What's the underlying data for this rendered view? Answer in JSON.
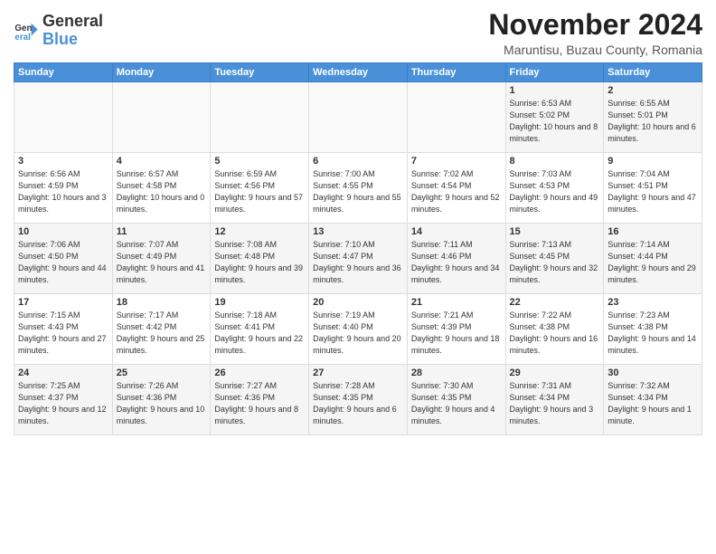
{
  "logo": {
    "line1": "General",
    "line2": "Blue"
  },
  "title": "November 2024",
  "subtitle": "Maruntisu, Buzau County, Romania",
  "weekdays": [
    "Sunday",
    "Monday",
    "Tuesday",
    "Wednesday",
    "Thursday",
    "Friday",
    "Saturday"
  ],
  "weeks": [
    [
      {
        "day": "",
        "info": ""
      },
      {
        "day": "",
        "info": ""
      },
      {
        "day": "",
        "info": ""
      },
      {
        "day": "",
        "info": ""
      },
      {
        "day": "",
        "info": ""
      },
      {
        "day": "1",
        "info": "Sunrise: 6:53 AM\nSunset: 5:02 PM\nDaylight: 10 hours and 8 minutes."
      },
      {
        "day": "2",
        "info": "Sunrise: 6:55 AM\nSunset: 5:01 PM\nDaylight: 10 hours and 6 minutes."
      }
    ],
    [
      {
        "day": "3",
        "info": "Sunrise: 6:56 AM\nSunset: 4:59 PM\nDaylight: 10 hours and 3 minutes."
      },
      {
        "day": "4",
        "info": "Sunrise: 6:57 AM\nSunset: 4:58 PM\nDaylight: 10 hours and 0 minutes."
      },
      {
        "day": "5",
        "info": "Sunrise: 6:59 AM\nSunset: 4:56 PM\nDaylight: 9 hours and 57 minutes."
      },
      {
        "day": "6",
        "info": "Sunrise: 7:00 AM\nSunset: 4:55 PM\nDaylight: 9 hours and 55 minutes."
      },
      {
        "day": "7",
        "info": "Sunrise: 7:02 AM\nSunset: 4:54 PM\nDaylight: 9 hours and 52 minutes."
      },
      {
        "day": "8",
        "info": "Sunrise: 7:03 AM\nSunset: 4:53 PM\nDaylight: 9 hours and 49 minutes."
      },
      {
        "day": "9",
        "info": "Sunrise: 7:04 AM\nSunset: 4:51 PM\nDaylight: 9 hours and 47 minutes."
      }
    ],
    [
      {
        "day": "10",
        "info": "Sunrise: 7:06 AM\nSunset: 4:50 PM\nDaylight: 9 hours and 44 minutes."
      },
      {
        "day": "11",
        "info": "Sunrise: 7:07 AM\nSunset: 4:49 PM\nDaylight: 9 hours and 41 minutes."
      },
      {
        "day": "12",
        "info": "Sunrise: 7:08 AM\nSunset: 4:48 PM\nDaylight: 9 hours and 39 minutes."
      },
      {
        "day": "13",
        "info": "Sunrise: 7:10 AM\nSunset: 4:47 PM\nDaylight: 9 hours and 36 minutes."
      },
      {
        "day": "14",
        "info": "Sunrise: 7:11 AM\nSunset: 4:46 PM\nDaylight: 9 hours and 34 minutes."
      },
      {
        "day": "15",
        "info": "Sunrise: 7:13 AM\nSunset: 4:45 PM\nDaylight: 9 hours and 32 minutes."
      },
      {
        "day": "16",
        "info": "Sunrise: 7:14 AM\nSunset: 4:44 PM\nDaylight: 9 hours and 29 minutes."
      }
    ],
    [
      {
        "day": "17",
        "info": "Sunrise: 7:15 AM\nSunset: 4:43 PM\nDaylight: 9 hours and 27 minutes."
      },
      {
        "day": "18",
        "info": "Sunrise: 7:17 AM\nSunset: 4:42 PM\nDaylight: 9 hours and 25 minutes."
      },
      {
        "day": "19",
        "info": "Sunrise: 7:18 AM\nSunset: 4:41 PM\nDaylight: 9 hours and 22 minutes."
      },
      {
        "day": "20",
        "info": "Sunrise: 7:19 AM\nSunset: 4:40 PM\nDaylight: 9 hours and 20 minutes."
      },
      {
        "day": "21",
        "info": "Sunrise: 7:21 AM\nSunset: 4:39 PM\nDaylight: 9 hours and 18 minutes."
      },
      {
        "day": "22",
        "info": "Sunrise: 7:22 AM\nSunset: 4:38 PM\nDaylight: 9 hours and 16 minutes."
      },
      {
        "day": "23",
        "info": "Sunrise: 7:23 AM\nSunset: 4:38 PM\nDaylight: 9 hours and 14 minutes."
      }
    ],
    [
      {
        "day": "24",
        "info": "Sunrise: 7:25 AM\nSunset: 4:37 PM\nDaylight: 9 hours and 12 minutes."
      },
      {
        "day": "25",
        "info": "Sunrise: 7:26 AM\nSunset: 4:36 PM\nDaylight: 9 hours and 10 minutes."
      },
      {
        "day": "26",
        "info": "Sunrise: 7:27 AM\nSunset: 4:36 PM\nDaylight: 9 hours and 8 minutes."
      },
      {
        "day": "27",
        "info": "Sunrise: 7:28 AM\nSunset: 4:35 PM\nDaylight: 9 hours and 6 minutes."
      },
      {
        "day": "28",
        "info": "Sunrise: 7:30 AM\nSunset: 4:35 PM\nDaylight: 9 hours and 4 minutes."
      },
      {
        "day": "29",
        "info": "Sunrise: 7:31 AM\nSunset: 4:34 PM\nDaylight: 9 hours and 3 minutes."
      },
      {
        "day": "30",
        "info": "Sunrise: 7:32 AM\nSunset: 4:34 PM\nDaylight: 9 hours and 1 minute."
      }
    ]
  ]
}
